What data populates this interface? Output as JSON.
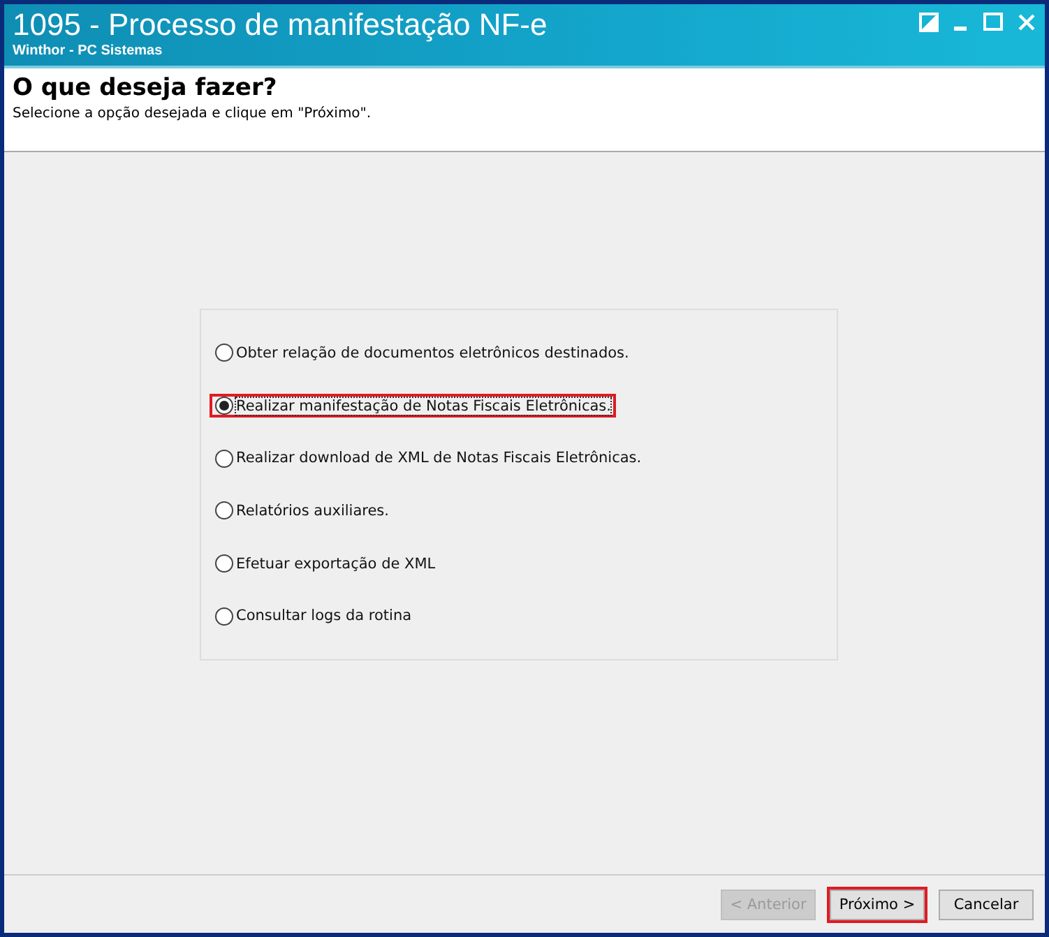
{
  "window": {
    "title": "1095 - Processo de manifestação NF-e",
    "subtitle": "Winthor - PC Sistemas"
  },
  "header": {
    "title": "O que deseja fazer?",
    "instruction": "Selecione a opção desejada e clique em \"Próximo\"."
  },
  "options": [
    {
      "label": "Obter relação de documentos eletrônicos destinados.",
      "selected": false,
      "highlighted": false
    },
    {
      "label": "Realizar manifestação de Notas Fiscais Eletrônicas.",
      "selected": true,
      "highlighted": true
    },
    {
      "label": "Realizar download de XML de Notas Fiscais Eletrônicas.",
      "selected": false,
      "highlighted": false
    },
    {
      "label": "Relatórios auxiliares.",
      "selected": false,
      "highlighted": false
    },
    {
      "label": "Efetuar exportação de XML",
      "selected": false,
      "highlighted": false
    },
    {
      "label": "Consultar logs da rotina",
      "selected": false,
      "highlighted": false
    }
  ],
  "buttons": [
    {
      "label": "< Anterior",
      "disabled": true,
      "highlighted": false
    },
    {
      "label": "Próximo >",
      "disabled": false,
      "highlighted": true
    },
    {
      "label": "Cancelar",
      "disabled": false,
      "highlighted": false
    }
  ]
}
